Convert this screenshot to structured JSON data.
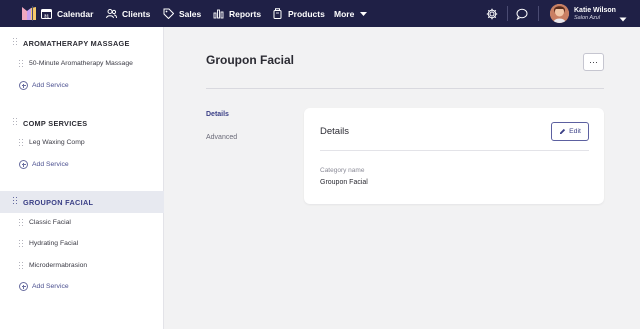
{
  "nav": {
    "items": [
      {
        "label": "Calendar",
        "icon": "calendar-icon"
      },
      {
        "label": "Clients",
        "icon": "clients-icon"
      },
      {
        "label": "Sales",
        "icon": "sales-tag-icon"
      },
      {
        "label": "Reports",
        "icon": "reports-icon"
      },
      {
        "label": "Products",
        "icon": "products-icon"
      },
      {
        "label": "More",
        "icon": "caret-down-icon"
      }
    ],
    "calendar_day": "31",
    "user": {
      "name": "Katie Wilson",
      "business": "Salon Azul"
    }
  },
  "sidebar": {
    "categories": [
      {
        "label": "AROMATHERAPY MASSAGE",
        "services": [
          "50-Minute Aromatherapy Massage"
        ],
        "add_label": "Add Service"
      },
      {
        "label": "COMP SERVICES",
        "services": [
          "Leg Waxing Comp"
        ],
        "add_label": "Add Service"
      },
      {
        "label": "GROUPON FACIAL",
        "services": [
          "Classic Facial",
          "Hydrating Facial",
          "Microdermabrasion"
        ],
        "add_label": "Add Service"
      }
    ]
  },
  "main": {
    "title": "Groupon Facial",
    "more_label": "···",
    "tabs": [
      {
        "label": "Details"
      },
      {
        "label": "Advanced"
      }
    ],
    "card": {
      "title": "Details",
      "edit_label": "Edit",
      "field_label": "Category name",
      "field_value": "Groupon Facial"
    }
  },
  "colors": {
    "nav_bg": "#1f2046",
    "accent": "#3a3f86",
    "active_row": "#e7e9f0",
    "page_bg": "#f2f2f3"
  }
}
